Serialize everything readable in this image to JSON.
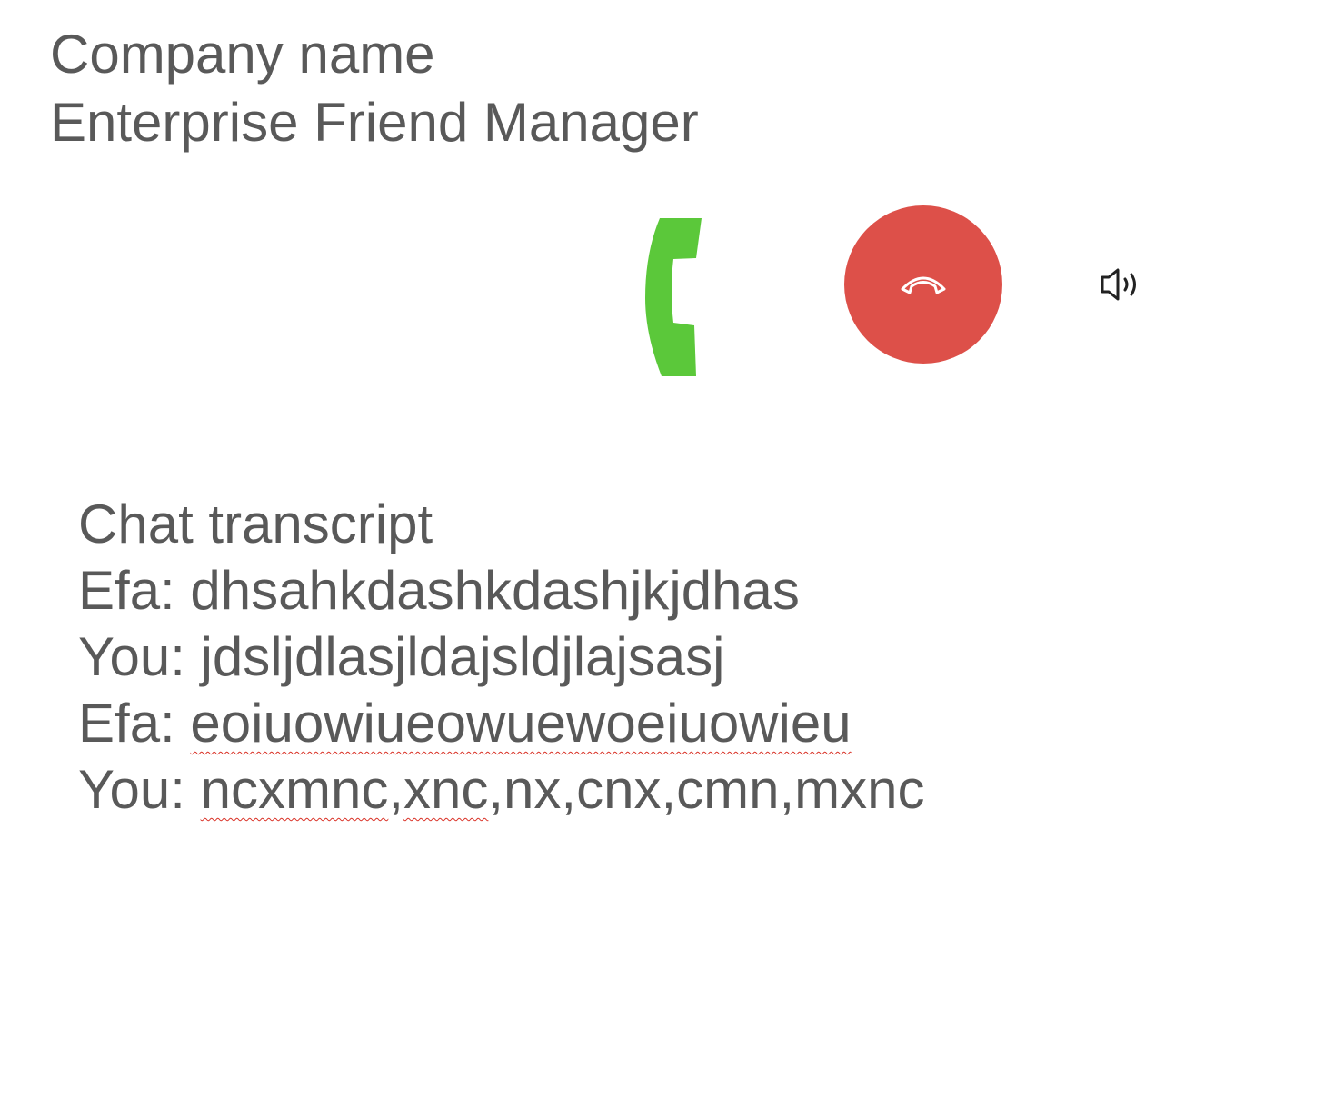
{
  "header": {
    "company": "Company name",
    "product": "Enterprise Friend Manager"
  },
  "controls": {
    "accept_icon": "phone-handset-icon",
    "end_icon": "hang-up-icon",
    "speaker_icon": "speaker-icon",
    "colors": {
      "accept": "#5bc83a",
      "end": "#dd5049",
      "end_icon": "#ffffff",
      "speaker": "#222222"
    }
  },
  "transcript": {
    "title": "Chat transcript",
    "lines": [
      {
        "speaker": "Efa:",
        "text": "dhsahkdashkdashjkjdhas"
      },
      {
        "speaker": "You:",
        "text": "jdsljdlasjldajsldjlajsasj"
      },
      {
        "speaker": "Efa:",
        "text": "eoiuowiueowuewoeiuowieu"
      },
      {
        "speaker": "You:",
        "text_part1": "ncxmnc",
        "comma1": ",",
        "text_part2": "xnc",
        "text_part3": ",nx,cnx,cmn,mxnc"
      }
    ]
  }
}
